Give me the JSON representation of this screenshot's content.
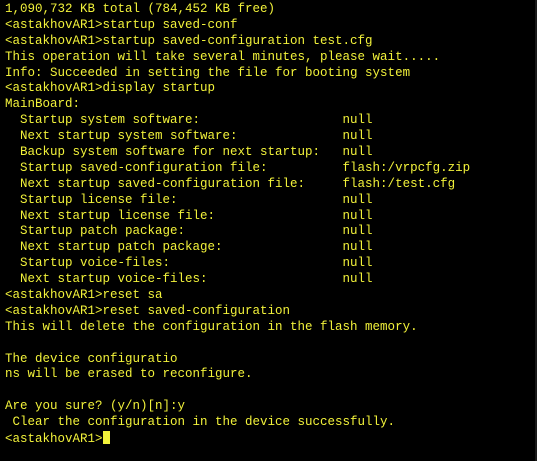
{
  "colors": {
    "background": "#000000",
    "text": "#f2f23a"
  },
  "terminal": {
    "lines": [
      "1,090,732 KB total (784,452 KB free)",
      "<astakhovAR1>startup saved-conf",
      "<astakhovAR1>startup saved-configuration test.cfg",
      "This operation will take several minutes, please wait.....",
      "Info: Succeeded in setting the file for booting system",
      "<astakhovAR1>display startup",
      "MainBoard:",
      "  Startup system software:                   null",
      "  Next startup system software:              null",
      "  Backup system software for next startup:   null",
      "  Startup saved-configuration file:          flash:/vrpcfg.zip",
      "  Next startup saved-configuration file:     flash:/test.cfg",
      "  Startup license file:                      null",
      "  Next startup license file:                 null",
      "  Startup patch package:                     null",
      "  Next startup patch package:                null",
      "  Startup voice-files:                       null",
      "  Next startup voice-files:                  null",
      "<astakhovAR1>reset sa",
      "<astakhovAR1>reset saved-configuration",
      "This will delete the configuration in the flash memory.",
      "",
      "The device configuratio",
      "ns will be erased to reconfigure.",
      "",
      "Are you sure? (y/n)[n]:y",
      " Clear the configuration in the device successfully.",
      "<astakhovAR1>"
    ]
  }
}
